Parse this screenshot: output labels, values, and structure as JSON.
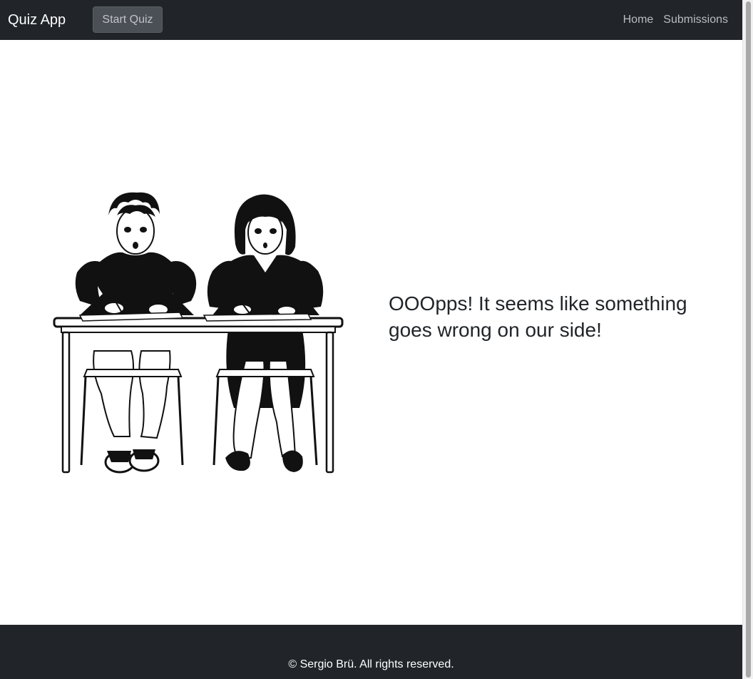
{
  "navbar": {
    "brand": "Quiz App",
    "start_button": "Start Quiz",
    "links": [
      "Home",
      "Submissions"
    ]
  },
  "main": {
    "error_message": "OOOpps! It seems like something goes wrong on our side!",
    "illustration": "two-students-at-desk-illustration"
  },
  "footer": {
    "copyright": "© Sergio Brü. All rights reserved."
  },
  "colors": {
    "navbar_bg": "#212529",
    "footer_bg": "#212529",
    "button_bg": "#4b5056",
    "text": "#212529"
  }
}
